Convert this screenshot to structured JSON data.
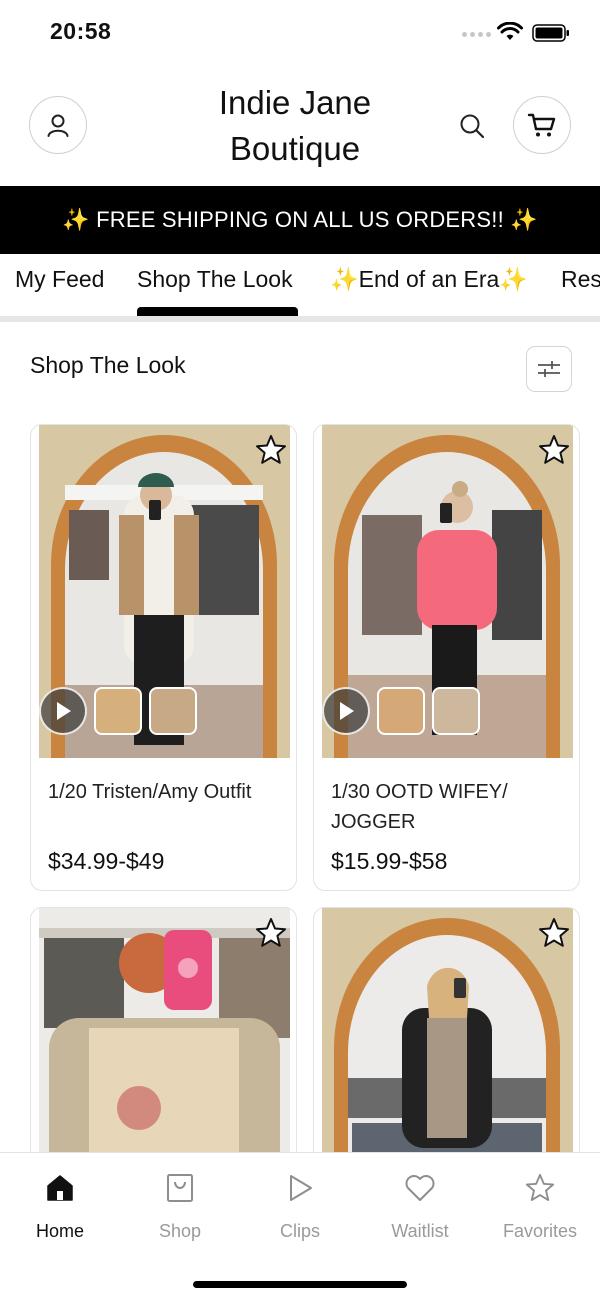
{
  "status_bar": {
    "time": "20:58"
  },
  "header": {
    "brand_line1": "Indie Jane",
    "brand_line2": "Boutique",
    "icons": {
      "account": "person-icon",
      "search": "search-icon",
      "cart": "cart-icon"
    }
  },
  "promo": {
    "text": "✨ FREE SHIPPING ON ALL US ORDERS!! ✨"
  },
  "tabs": [
    {
      "label": "My Feed",
      "active": false
    },
    {
      "label": "Shop The Look",
      "active": true
    },
    {
      "label": "✨End of an Era✨",
      "active": false
    },
    {
      "label": "Res",
      "active": false
    }
  ],
  "section": {
    "title": "Shop The Look",
    "filter_icon": "sliders-icon"
  },
  "products": [
    {
      "title": "1/20 Tristen/Amy Outfit",
      "price": "$34.99-$49",
      "has_video": true,
      "favorited": false
    },
    {
      "title": "1/30 OOTD WIFEY/ JOGGER",
      "price": "$15.99-$58",
      "has_video": true,
      "favorited": false
    },
    {
      "title": "",
      "price": "",
      "has_video": false,
      "favorited": false
    },
    {
      "title": "",
      "price": "",
      "has_video": false,
      "favorited": false
    }
  ],
  "bottom_nav": [
    {
      "label": "Home",
      "icon": "home-icon",
      "active": true
    },
    {
      "label": "Shop",
      "icon": "shopping-bag-icon",
      "active": false
    },
    {
      "label": "Clips",
      "icon": "play-icon",
      "active": false
    },
    {
      "label": "Waitlist",
      "icon": "heart-icon",
      "active": false
    },
    {
      "label": "Favorites",
      "icon": "star-icon",
      "active": false
    }
  ],
  "colors": {
    "accent": "#000000",
    "promo_bg": "#000000",
    "inactive_nav": "#9a9a9a",
    "rattan": "#d9c9a6"
  }
}
